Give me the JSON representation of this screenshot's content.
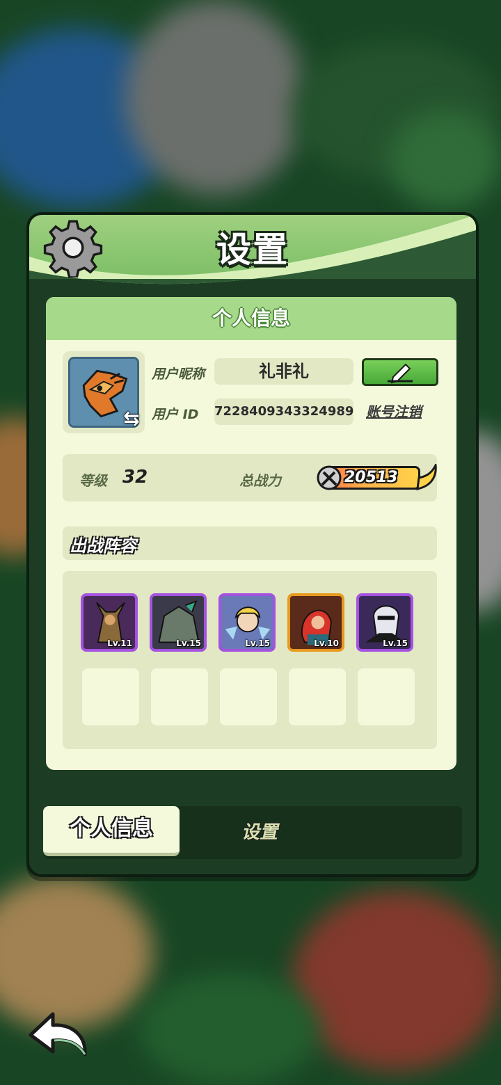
{
  "panel": {
    "title": "设置",
    "card_title": "个人信息"
  },
  "profile": {
    "nickname_label": "用户昵称",
    "nickname": "礼非礼",
    "id_label": "用户 ID",
    "user_id": "7228409343324989",
    "cancel_account": "账号注销"
  },
  "stats": {
    "level_label": "等级",
    "level": "32",
    "power_label": "总战力",
    "power": "20513"
  },
  "lineup": {
    "title": "出战阵容",
    "heroes": [
      {
        "level": "Lv.11",
        "rarity": "purple"
      },
      {
        "level": "Lv.15",
        "rarity": "purple"
      },
      {
        "level": "Lv.15",
        "rarity": "purple"
      },
      {
        "level": "Lv.10",
        "rarity": "orange"
      },
      {
        "level": "Lv.15",
        "rarity": "purple"
      }
    ],
    "empty_slots": 5
  },
  "tabs": {
    "active": "个人信息",
    "inactive": "设置"
  },
  "colors": {
    "header_green": "#7dbf66",
    "card_bg": "#f4f9dc",
    "panel_dark": "#1c3d24",
    "edit_button": "#48a838"
  },
  "icons": [
    "gear-icon",
    "swap-icon",
    "edit-pencil-icon",
    "sword-icon",
    "back-arrow-icon"
  ]
}
